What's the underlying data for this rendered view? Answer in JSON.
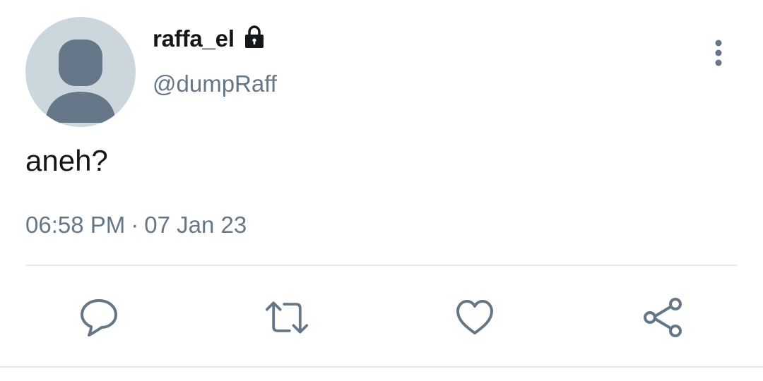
{
  "tweet": {
    "display_name": "raffa_el",
    "handle": "@dumpRaff",
    "text": "aneh?",
    "time": "06:58 PM",
    "separator": "·",
    "date": "07 Jan 23"
  },
  "icons": {
    "lock": "lock-icon",
    "more": "more-vertical-icon",
    "reply": "reply-icon",
    "retweet": "retweet-icon",
    "like": "heart-icon",
    "share": "share-icon"
  },
  "colors": {
    "primary_text": "#14171a",
    "secondary_text": "#657786",
    "avatar_bg": "#ccd6dd",
    "avatar_figure": "#66778a",
    "divider": "#e6ecf0"
  }
}
